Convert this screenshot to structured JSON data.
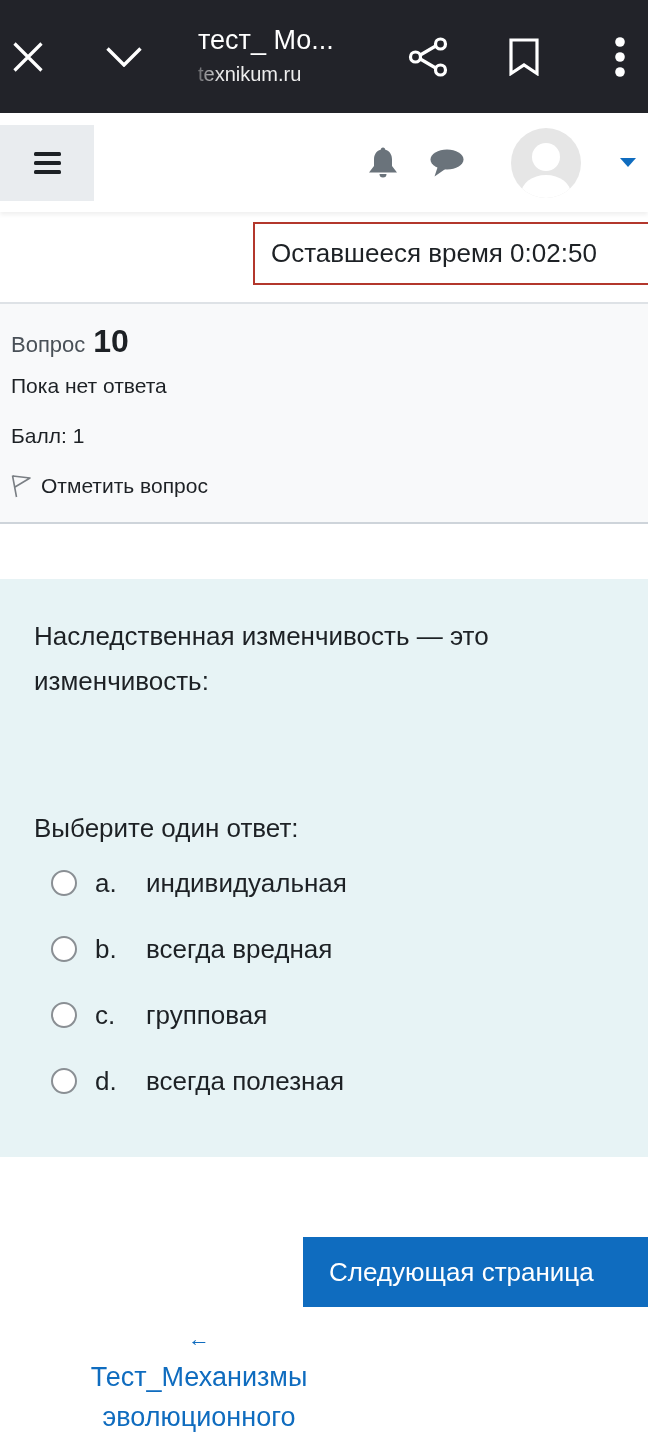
{
  "browser_bar": {
    "title": "тест_ Мо...",
    "url": "texnikum.ru"
  },
  "timer": {
    "label": "Оставшееся время 0:02:50"
  },
  "question_info": {
    "label": "Вопрос",
    "number": "10",
    "state": "Пока нет ответа",
    "grade": "Балл: 1",
    "flag": {
      "label": "Отметить вопрос",
      "flagged": false
    }
  },
  "question": {
    "text": "Наследственная изменчивость — это изменчивость:",
    "prompt": "Выберите один ответ:",
    "options": [
      {
        "letter": "a.",
        "text": "индивидуальная",
        "selected": false
      },
      {
        "letter": "b.",
        "text": "всегда вредная",
        "selected": false
      },
      {
        "letter": "c.",
        "text": "групповая",
        "selected": false
      },
      {
        "letter": "d.",
        "text": "всегда полезная",
        "selected": false
      }
    ]
  },
  "next_button": "Следующая страница",
  "prev_link": {
    "arrow": "←",
    "label": "Тест_Механизмы эволюционного"
  }
}
